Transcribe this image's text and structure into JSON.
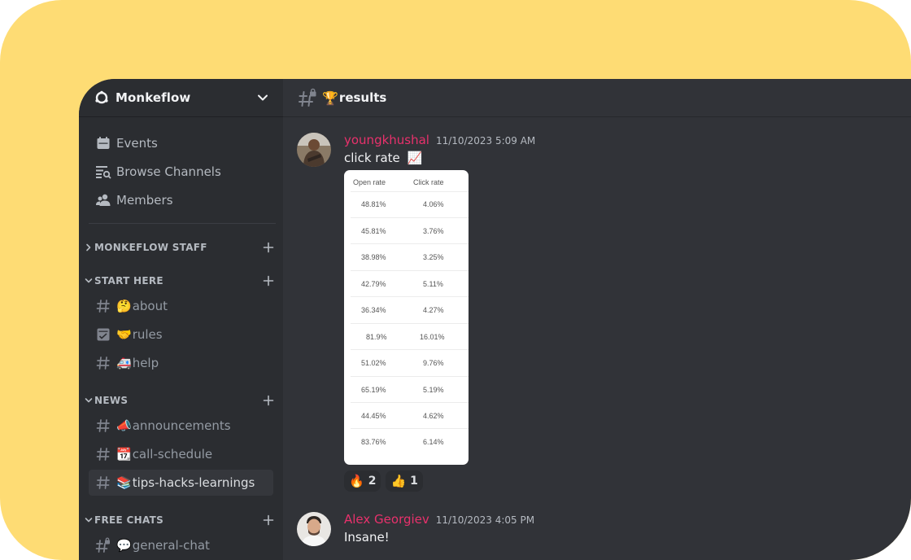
{
  "server": {
    "name": "Monkeflow"
  },
  "nav": [
    {
      "label": "Events",
      "icon": "calendar-icon"
    },
    {
      "label": "Browse Channels",
      "icon": "browse-channels-icon"
    },
    {
      "label": "Members",
      "icon": "members-icon"
    }
  ],
  "categories": [
    {
      "label": "MONKEFLOW STAFF",
      "collapsed": true,
      "channels": []
    },
    {
      "label": "START HERE",
      "collapsed": false,
      "channels": [
        {
          "emoji": "🤔",
          "name": "about",
          "icon": "hash-icon"
        },
        {
          "emoji": "🤝",
          "name": "rules",
          "icon": "rules-checkbox-icon"
        },
        {
          "emoji": "🚑",
          "name": "help",
          "icon": "hash-icon"
        }
      ]
    },
    {
      "label": "NEWS",
      "collapsed": false,
      "channels": [
        {
          "emoji": "📣",
          "name": "announcements",
          "icon": "hash-icon"
        },
        {
          "emoji": "📆",
          "name": "call-schedule",
          "icon": "hash-icon"
        },
        {
          "emoji": "📚",
          "name": "tips-hacks-learnings",
          "icon": "hash-icon",
          "active": true
        }
      ]
    },
    {
      "label": "FREE CHATS",
      "collapsed": false,
      "channels": [
        {
          "emoji": "💬",
          "name": "general-chat",
          "icon": "locked-hash-icon"
        }
      ]
    }
  ],
  "channel_header": {
    "emoji": "🏆",
    "name": "results",
    "icon": "locked-hash-icon"
  },
  "messages": [
    {
      "author": "youngkhushal",
      "timestamp": "11/10/2023 5:09 AM",
      "text": "click rate",
      "text_emoji": "📈",
      "attachment": {
        "columns": [
          "Open rate",
          "Click rate"
        ],
        "rows": [
          [
            "48.81%",
            "4.06%"
          ],
          [
            "45.81%",
            "3.76%"
          ],
          [
            "38.98%",
            "3.25%"
          ],
          [
            "42.79%",
            "5.11%"
          ],
          [
            "36.34%",
            "4.27%"
          ],
          [
            "81.9%",
            "16.01%"
          ],
          [
            "51.02%",
            "9.76%"
          ],
          [
            "65.19%",
            "5.19%"
          ],
          [
            "44.45%",
            "4.62%"
          ],
          [
            "83.76%",
            "6.14%"
          ]
        ]
      },
      "reactions": [
        {
          "emoji": "🔥",
          "count": "2"
        },
        {
          "emoji": "👍",
          "count": "1"
        }
      ]
    },
    {
      "author": "Alex Georgiev",
      "timestamp": "11/10/2023 4:05 PM",
      "text": "Insane!"
    }
  ],
  "colors": {
    "background": "#fedc74",
    "sidebar": "#2b2d31",
    "chat": "#313338",
    "username": "#e8316c"
  }
}
